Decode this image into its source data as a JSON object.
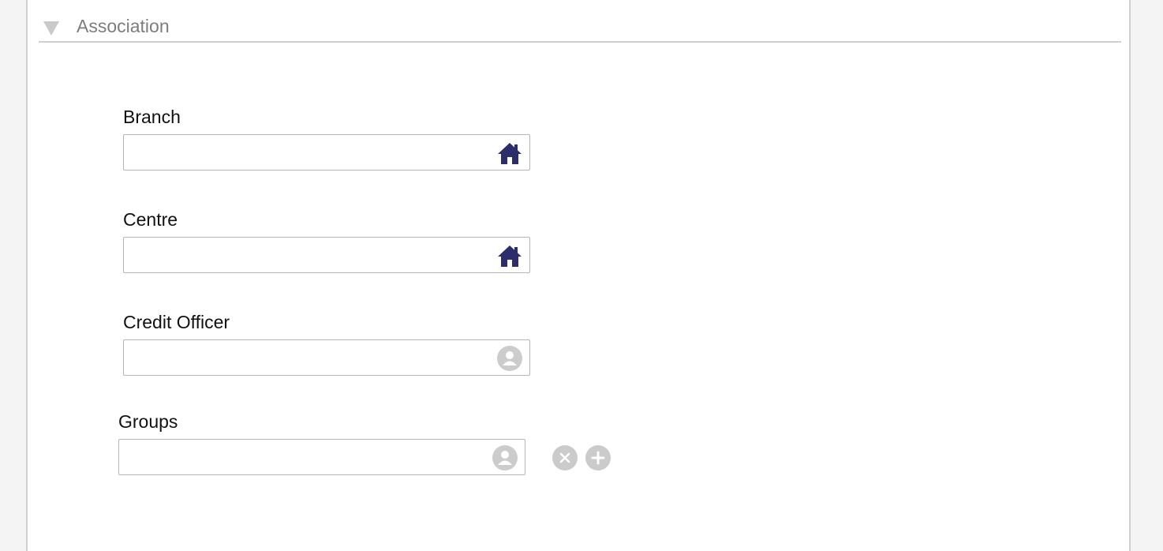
{
  "section": {
    "title": "Association",
    "toggle_icon": "triangle-down-icon"
  },
  "fields": {
    "branch": {
      "label": "Branch",
      "value": "",
      "icon": "home-icon"
    },
    "centre": {
      "label": "Centre",
      "value": "",
      "icon": "home-icon"
    },
    "credit_officer": {
      "label": "Credit Officer",
      "value": "",
      "icon": "person-icon"
    },
    "groups": {
      "label": "Groups",
      "value": "",
      "icon": "person-icon"
    }
  },
  "group_actions": {
    "remove_icon": "remove-circle-icon",
    "add_icon": "add-circle-icon"
  },
  "colors": {
    "home_icon": "#2e2d6b",
    "person_icon": "#cccccc",
    "header_text": "#7d7d7d",
    "divider": "#cfcfcf"
  }
}
